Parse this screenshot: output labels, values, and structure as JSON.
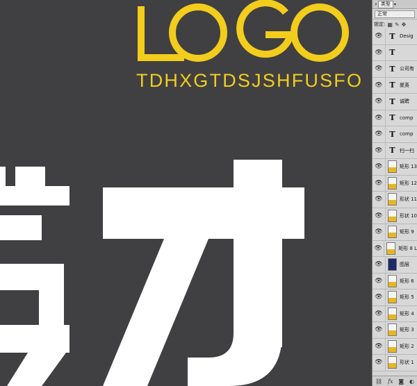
{
  "canvas": {
    "logo_text": "TDHXGTDSJSHFUSFO",
    "logo_color": "#f2cd1c",
    "background": "#404042"
  },
  "layers_panel": {
    "filter_label": "类型",
    "blend_mode": "正常",
    "lock_label": "锁定:",
    "layers": [
      {
        "type": "text",
        "name": "Desig"
      },
      {
        "type": "text",
        "name": ""
      },
      {
        "type": "text",
        "name": "公司有"
      },
      {
        "type": "text",
        "name": "聚英"
      },
      {
        "type": "text",
        "name": "诚聘"
      },
      {
        "type": "text",
        "name": "comp"
      },
      {
        "type": "text",
        "name": "comp"
      },
      {
        "type": "text",
        "name": "扫一扫"
      },
      {
        "type": "shape",
        "name": "矩形 13"
      },
      {
        "type": "shape",
        "name": "矩形 12"
      },
      {
        "type": "shape",
        "name": "形状 11"
      },
      {
        "type": "shape",
        "name": "形状 10"
      },
      {
        "type": "shape",
        "name": "矩形 9"
      },
      {
        "type": "shape",
        "name": "矩形 8 L"
      },
      {
        "type": "image",
        "name": "图层"
      },
      {
        "type": "shape",
        "name": "矩形 6"
      },
      {
        "type": "shape",
        "name": "矩形 5"
      },
      {
        "type": "shape",
        "name": "矩形 4"
      },
      {
        "type": "shape",
        "name": "矩形 3"
      },
      {
        "type": "shape",
        "name": "矩形 2"
      },
      {
        "type": "shape",
        "name": "形状 1"
      }
    ],
    "bottom_icons": [
      "link-icon",
      "fx-icon",
      "mask-icon",
      "adjust-icon"
    ]
  }
}
